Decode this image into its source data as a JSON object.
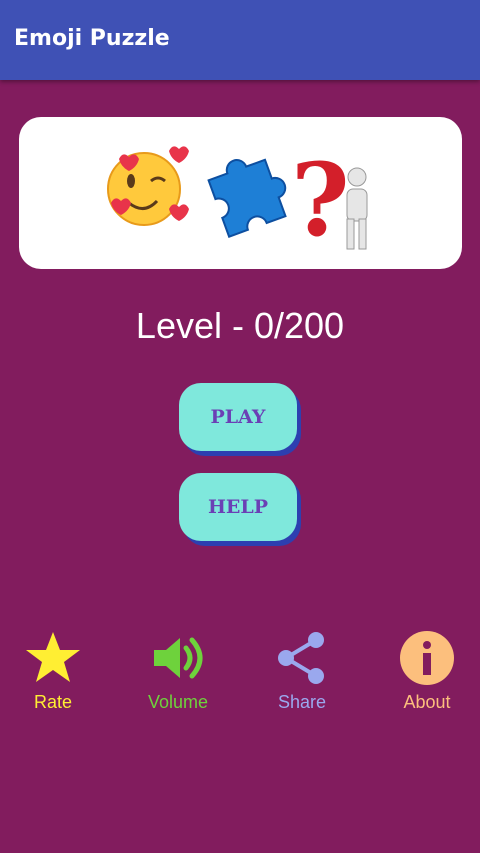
{
  "app": {
    "title": "Emoji Puzzle"
  },
  "level": {
    "text": "Level - 0/200"
  },
  "buttons": {
    "play": "PLAY",
    "help": "HELP"
  },
  "bottom": [
    {
      "label": "Rate",
      "icon": "star-icon",
      "color": "#ffee33"
    },
    {
      "label": "Volume",
      "icon": "speaker-icon",
      "color": "#6ed23c"
    },
    {
      "label": "Share",
      "icon": "share-icon",
      "color": "#9aa8ee"
    },
    {
      "label": "About",
      "icon": "info-icon",
      "color": "#fcbf7d"
    }
  ],
  "colors": {
    "background": "#821c5e",
    "appbar": "#3f51b5",
    "button": "#7fe8dc",
    "button_shadow": "#2d3fb0",
    "button_text": "#6b3fb5"
  }
}
